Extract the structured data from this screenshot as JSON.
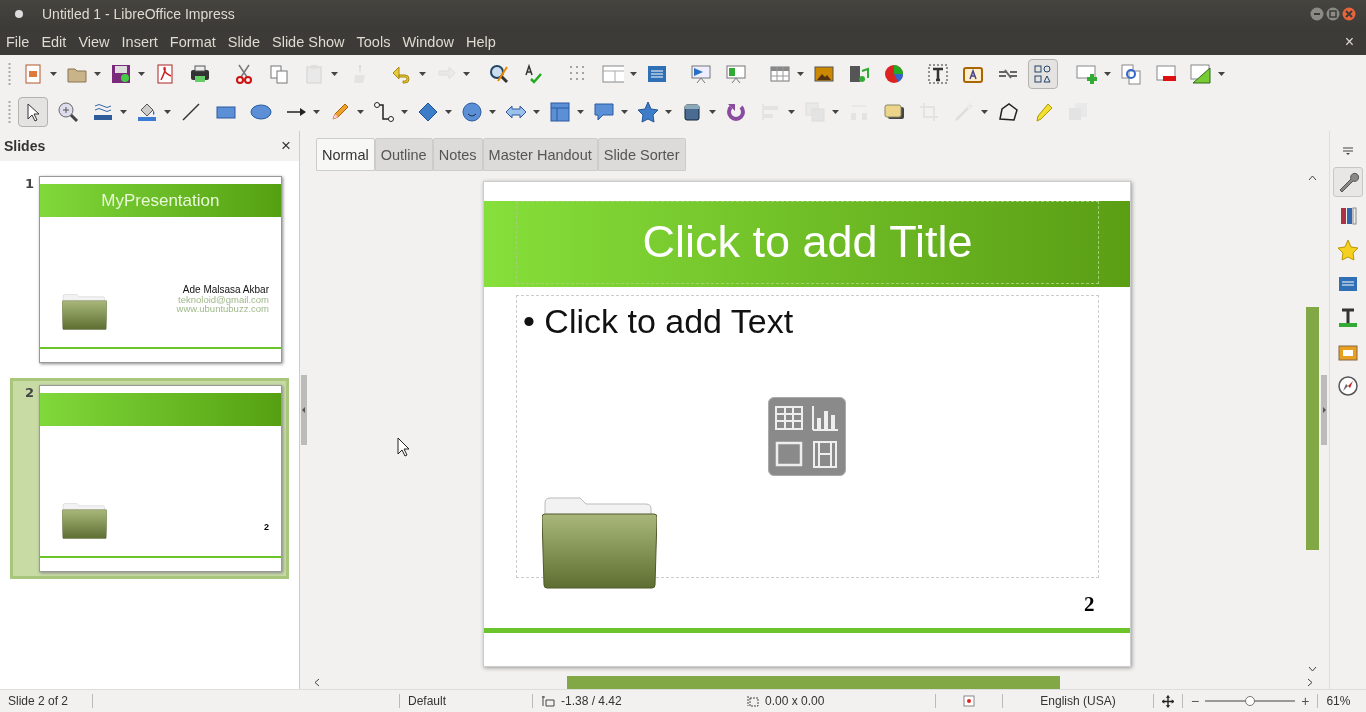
{
  "window": {
    "title": "Untitled 1 - LibreOffice Impress"
  },
  "menu": {
    "items": [
      "File",
      "Edit",
      "View",
      "Insert",
      "Format",
      "Slide",
      "Slide Show",
      "Tools",
      "Window",
      "Help"
    ],
    "close": "×"
  },
  "toolbars": [
    [
      {
        "disabled": false,
        "pressed": false
      },
      {
        "disabled": false,
        "pressed": false
      },
      {
        "disabled": false,
        "pressed": false
      },
      {
        "disabled": false,
        "pressed": false
      },
      {
        "disabled": false,
        "pressed": false
      },
      {
        "disabled": false,
        "pressed": false
      },
      {
        "disabled": false,
        "pressed": false
      },
      {
        "disabled": true,
        "pressed": false
      },
      {
        "disabled": true,
        "pressed": false
      },
      {
        "disabled": false,
        "pressed": false
      },
      {
        "disabled": true,
        "pressed": false
      },
      {
        "disabled": false,
        "pressed": false
      },
      {
        "disabled": false,
        "pressed": false
      },
      {
        "disabled": false,
        "pressed": false
      },
      {
        "disabled": false,
        "pressed": false
      },
      {
        "disabled": false,
        "pressed": false
      },
      {
        "disabled": false,
        "pressed": false
      },
      {
        "disabled": false,
        "pressed": false
      },
      {
        "disabled": false,
        "pressed": false
      },
      {
        "disabled": false,
        "pressed": false
      },
      {
        "disabled": false,
        "pressed": false
      },
      {
        "disabled": false,
        "pressed": false
      },
      {
        "disabled": false,
        "pressed": false
      },
      {
        "disabled": false,
        "pressed": false
      },
      {
        "disabled": false,
        "pressed": false
      },
      {
        "disabled": false,
        "pressed": true
      },
      {
        "disabled": false,
        "pressed": false
      },
      {
        "disabled": false,
        "pressed": false
      },
      {
        "disabled": false,
        "pressed": false
      },
      {
        "disabled": false,
        "pressed": false
      }
    ],
    [
      {
        "disabled": false,
        "pressed": true
      },
      {
        "disabled": false,
        "pressed": false
      },
      {
        "disabled": false,
        "pressed": false
      },
      {
        "disabled": false,
        "pressed": false
      },
      {
        "disabled": false,
        "pressed": false
      },
      {
        "disabled": false,
        "pressed": false
      },
      {
        "disabled": false,
        "pressed": false
      },
      {
        "disabled": false,
        "pressed": false
      },
      {
        "disabled": false,
        "pressed": false
      },
      {
        "disabled": false,
        "pressed": false
      },
      {
        "disabled": false,
        "pressed": false
      },
      {
        "disabled": false,
        "pressed": false
      },
      {
        "disabled": false,
        "pressed": false
      },
      {
        "disabled": false,
        "pressed": false
      },
      {
        "disabled": false,
        "pressed": false
      },
      {
        "disabled": false,
        "pressed": false
      },
      {
        "disabled": false,
        "pressed": false
      },
      {
        "disabled": false,
        "pressed": false
      },
      {
        "disabled": true,
        "pressed": false
      },
      {
        "disabled": true,
        "pressed": false
      },
      {
        "disabled": true,
        "pressed": false
      },
      {
        "disabled": false,
        "pressed": false
      },
      {
        "disabled": true,
        "pressed": false
      },
      {
        "disabled": true,
        "pressed": false
      },
      {
        "disabled": false,
        "pressed": false
      },
      {
        "disabled": false,
        "pressed": false
      },
      {
        "disabled": true,
        "pressed": false
      }
    ]
  ],
  "slides_pane": {
    "title": "Slides",
    "close": "×",
    "slides": [
      {
        "number": "1",
        "selected": false,
        "title": "MyPresentation",
        "author": "Ade Malsasa Akbar",
        "email": "teknoloid@gmail.com",
        "website": "www.ubuntubuzz.com"
      },
      {
        "number": "2",
        "selected": true,
        "page_number": "2"
      }
    ]
  },
  "view_tabs": [
    {
      "label": "Normal",
      "selected": true
    },
    {
      "label": "Outline",
      "selected": false
    },
    {
      "label": "Notes",
      "selected": false
    },
    {
      "label": "Master Handout",
      "selected": false
    },
    {
      "label": "Slide Sorter",
      "selected": false
    }
  ],
  "slide": {
    "title_placeholder": "Click to add Title",
    "bullet": "•",
    "text_placeholder": "Click to add Text",
    "page_number": "2"
  },
  "status_bar": {
    "slide": "Slide 2 of 2",
    "master": "Default",
    "position": "-1.38 / 4.42",
    "size": "0.00 x 0.00",
    "language": "English (USA)",
    "zoom_minus": "−",
    "zoom_plus": "+",
    "zoom_slider": {
      "level": 0.5
    },
    "zoom": "61%"
  }
}
